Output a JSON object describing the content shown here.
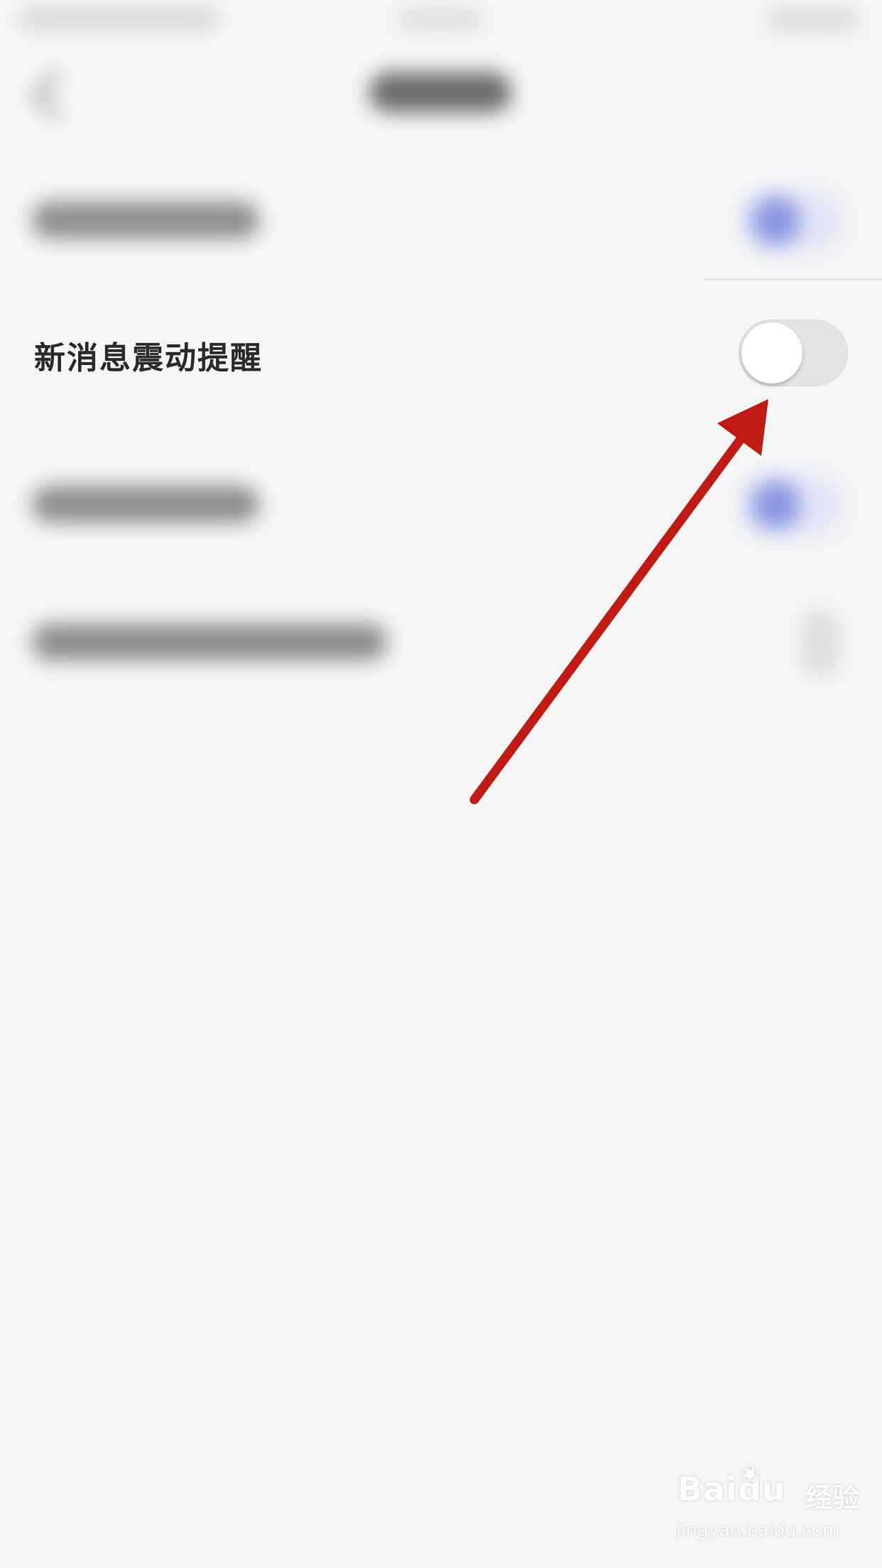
{
  "setting": {
    "label": "新消息震动提醒",
    "toggle_state": "off"
  },
  "watermark": {
    "brand": "Baidu",
    "suffix": "经验",
    "url": "jingyan.baidu.com"
  },
  "colors": {
    "background": "#f6f6f7",
    "arrow": "#c01a12",
    "toggle_off_track": "#e3e3e5",
    "toggle_knob": "#ffffff",
    "blurred_toggle_on": "#8b98e2"
  }
}
